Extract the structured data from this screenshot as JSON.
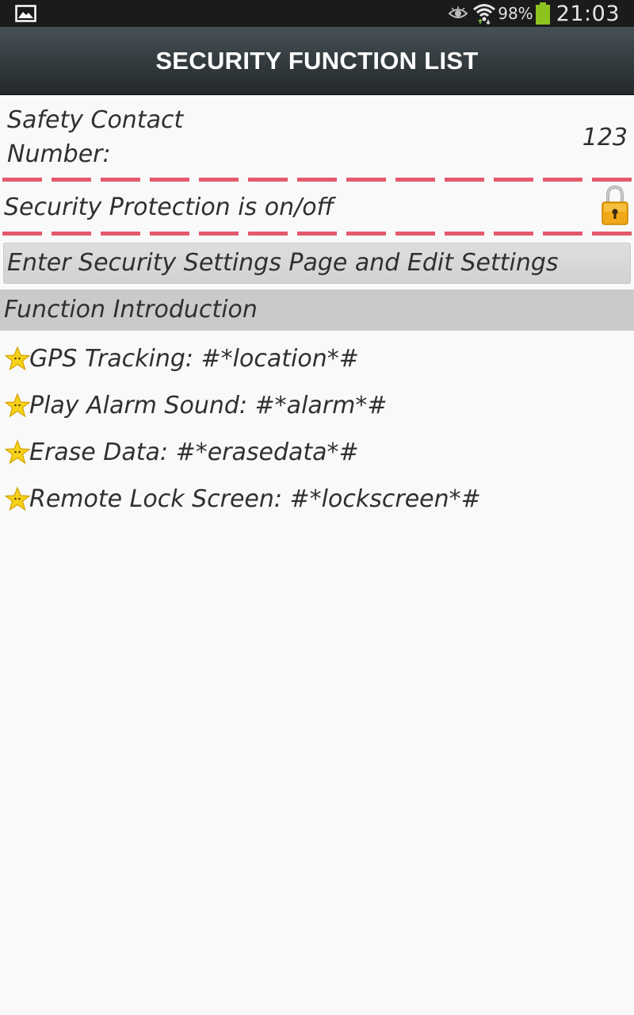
{
  "status_bar": {
    "left_icon": "image-notification-icon",
    "icons": [
      "eye-icon",
      "wifi-icon",
      "battery-icon"
    ],
    "battery_percent": "98%",
    "time": "21:03"
  },
  "title_bar": {
    "title": "SECURITY FUNCTION LIST"
  },
  "contact": {
    "label_line1": "Safety Contact",
    "label_line2": "Number:",
    "value": "123"
  },
  "protection": {
    "label": "Security Protection is on/off",
    "icon": "lock-icon"
  },
  "settings_button": {
    "label": "Enter Security Settings Page and Edit Settings"
  },
  "intro": {
    "header": "Function Introduction",
    "items": [
      {
        "icon": "star-icon",
        "text": "GPS Tracking: #*location*#"
      },
      {
        "icon": "star-icon",
        "text": "Play Alarm Sound: #*alarm*#"
      },
      {
        "icon": "star-icon",
        "text": "Erase Data: #*erasedata*#"
      },
      {
        "icon": "star-icon",
        "text": "Remote Lock Screen: #*lockscreen*#"
      }
    ]
  },
  "colors": {
    "status_bar_bg": "#1b1b1b",
    "title_bar_bg": "#363e42",
    "divider": "#e4596b",
    "button_bg": "#d8d8d8",
    "section_header_bg": "#cacaca",
    "page_bg": "#f9f9f9"
  }
}
